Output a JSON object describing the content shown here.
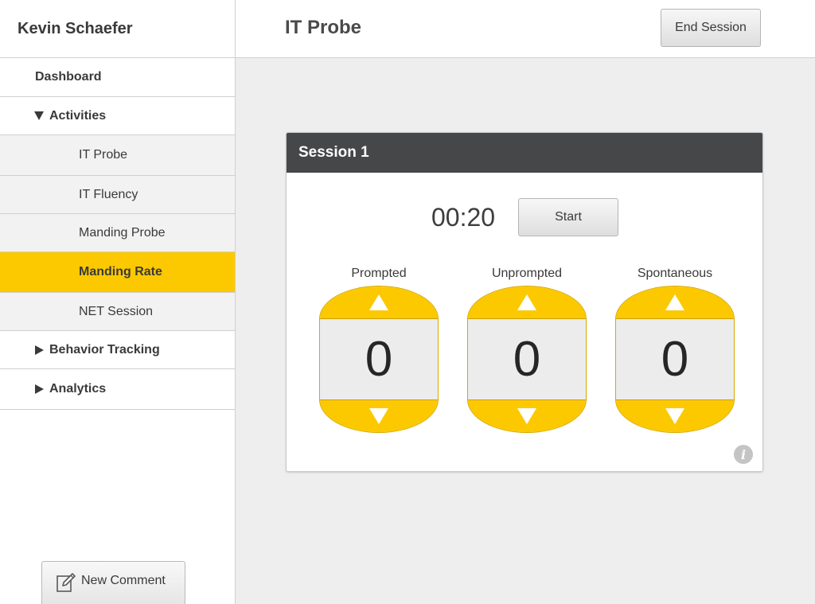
{
  "sidebar": {
    "user_name": "Kevin Schaefer",
    "items": [
      {
        "label": "Dashboard"
      },
      {
        "label": "Activities"
      },
      {
        "label": "IT Probe"
      },
      {
        "label": "IT Fluency"
      },
      {
        "label": "Manding Probe"
      },
      {
        "label": "Manding Rate"
      },
      {
        "label": "NET Session"
      },
      {
        "label": "Behavior Tracking"
      },
      {
        "label": "Analytics"
      }
    ],
    "selected": "Manding Rate",
    "new_comment_label": "New Comment"
  },
  "header": {
    "title": "IT Probe",
    "end_session_label": "End Session"
  },
  "session": {
    "title": "Session 1",
    "timer": "00:20",
    "start_label": "Start",
    "counters": [
      {
        "label": "Prompted",
        "value": "0"
      },
      {
        "label": "Unprompted",
        "value": "0"
      },
      {
        "label": "Spontaneous",
        "value": "0"
      }
    ],
    "info_icon": "info-icon"
  },
  "colors": {
    "accent": "#fcc900",
    "card_header": "#454748",
    "background": "#eeeeee"
  }
}
